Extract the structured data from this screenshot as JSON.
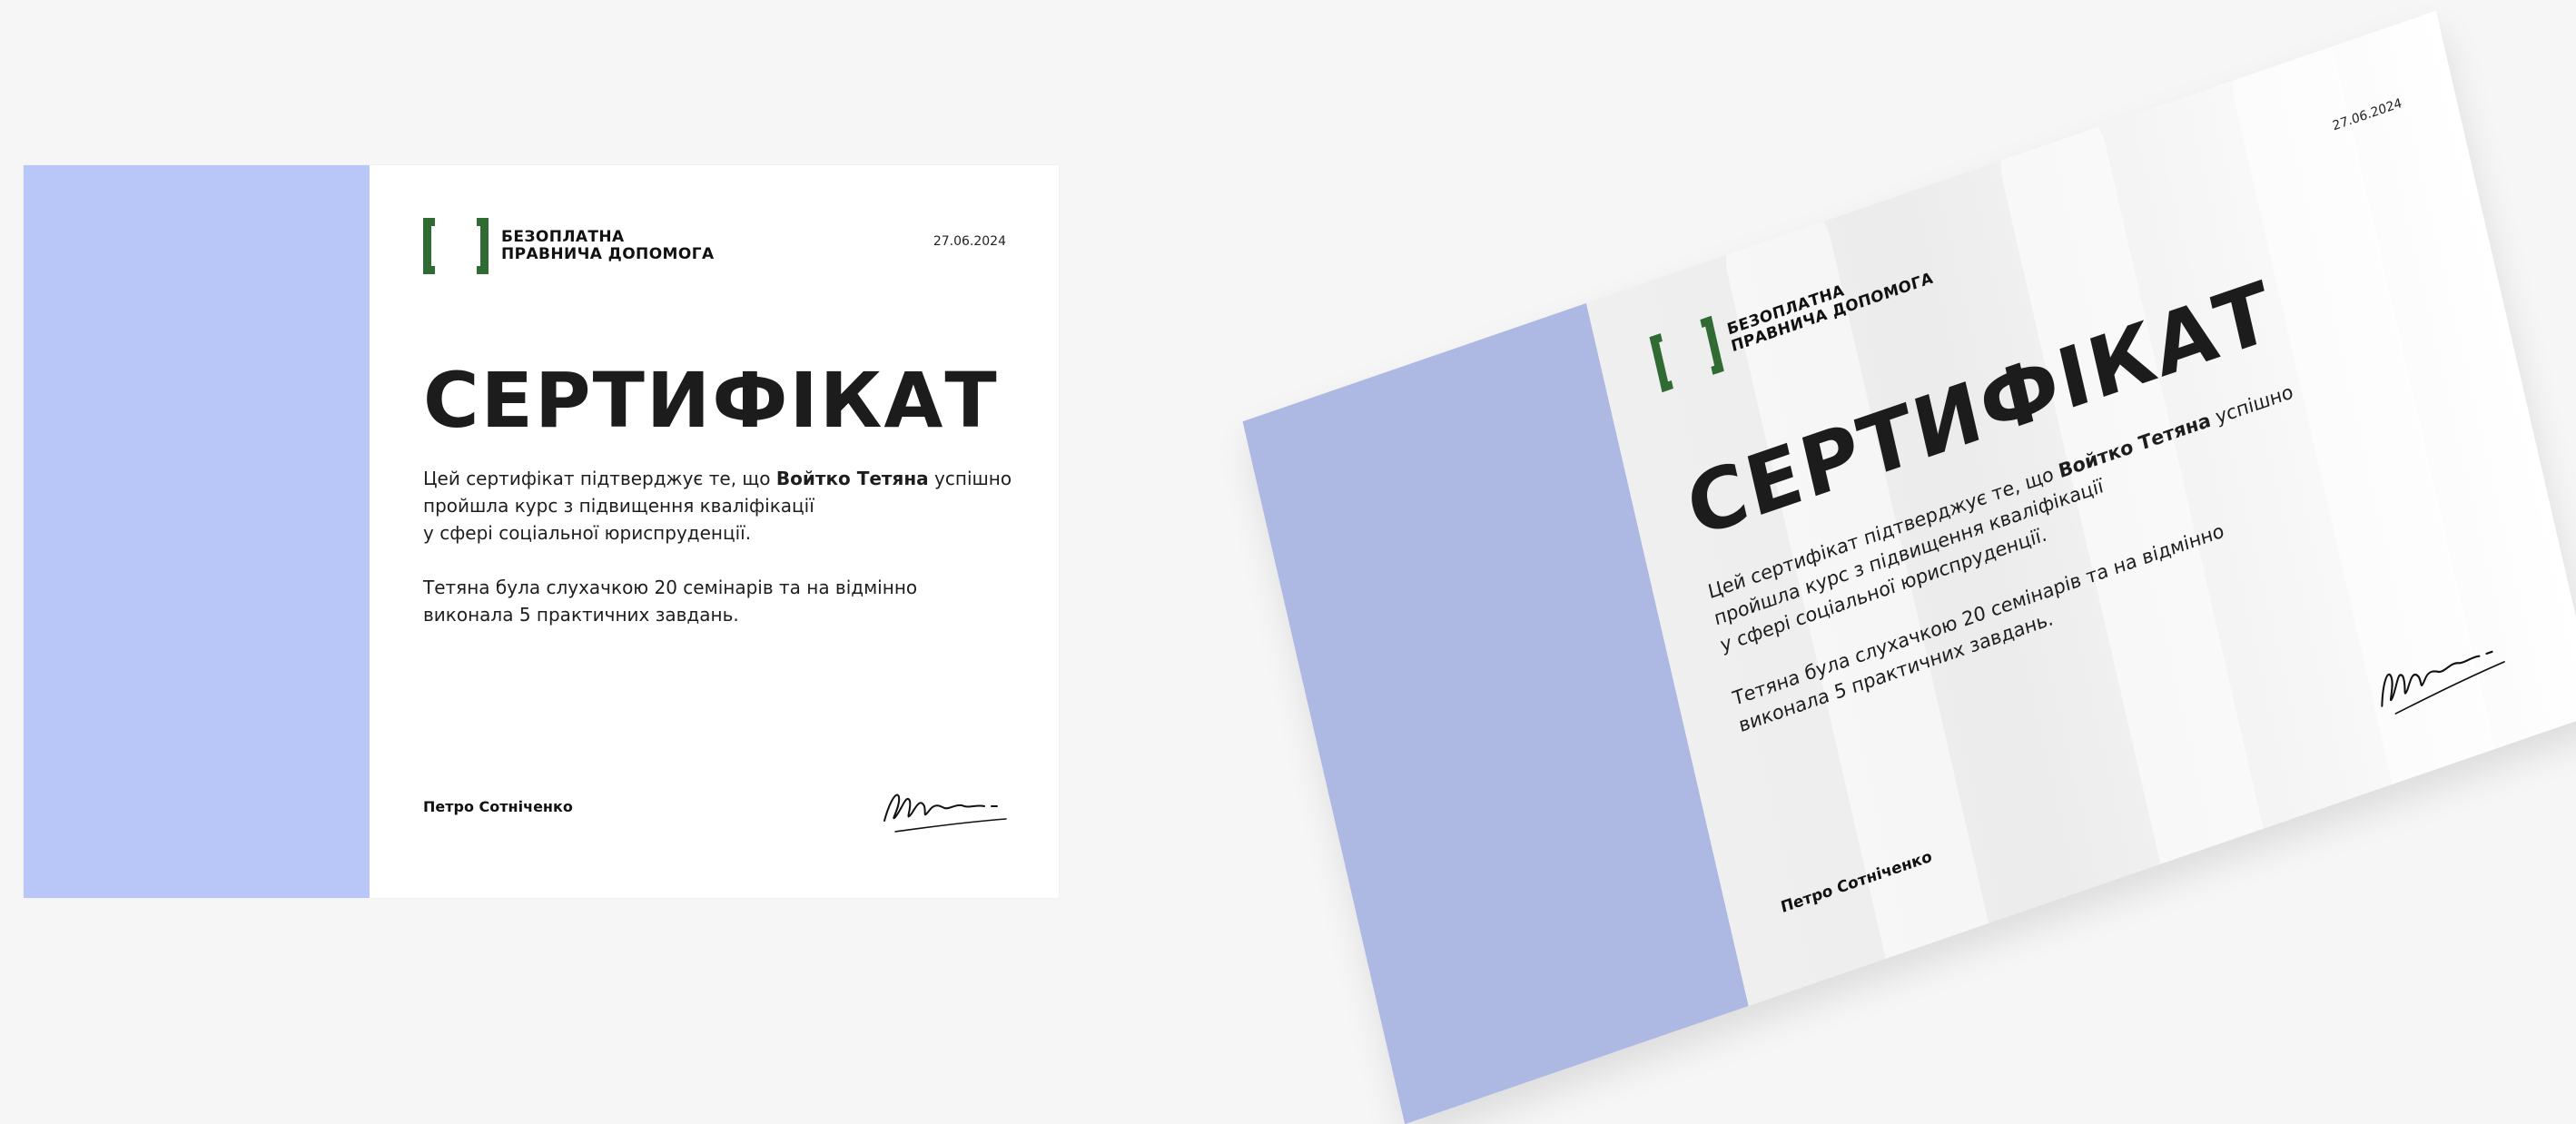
{
  "certificate": {
    "logo_line1": "БЕЗОПЛАТНА",
    "logo_line2": "ПРАВНИЧА ДОПОМОГА",
    "date": "27.06.2024",
    "title": "СЕРТИФІКАТ",
    "body_before_name": "Цей сертифікат підтверджує те, що ",
    "recipient_name": "Войтко Тетяна",
    "body_after_name_1": " успішно",
    "body_line2": "пройшла курс з підвищення кваліфікації",
    "body_line3": "у сфері соціальної юриспруденції.",
    "paragraph2_line1": "Тетяна була слухачкою 20 семінарів та на відмінно",
    "paragraph2_line2": "виконала 5 практичних завдань.",
    "signer_name": "Петро Сотніченко"
  },
  "colors": {
    "page_background": "#f6f6f6",
    "pattern_light": "#b8c7f8",
    "pattern_mid": "#a4b5f2",
    "pattern_dark": "#8fa3ea",
    "logo_green": "#2f6b33",
    "text_dark": "#1c1c1c"
  }
}
